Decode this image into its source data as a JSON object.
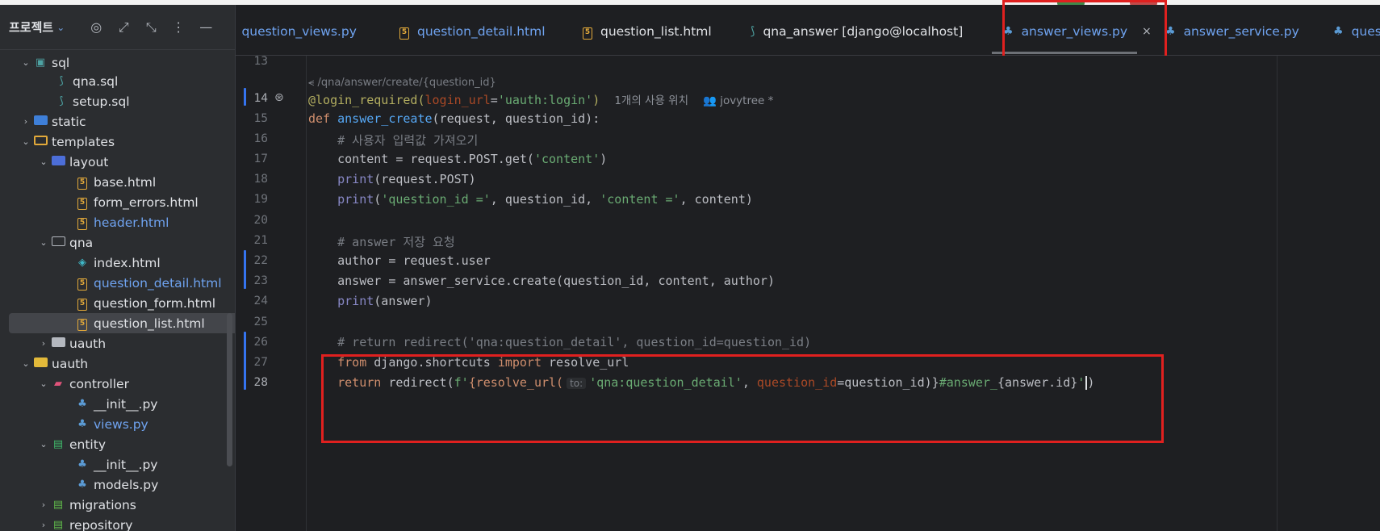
{
  "sidebar": {
    "title": "프로젝트",
    "tree": [
      {
        "label": "sql",
        "kind": "folder-sql",
        "expanded": true
      },
      {
        "label": "qna.sql",
        "kind": "sql"
      },
      {
        "label": "setup.sql",
        "kind": "sql"
      },
      {
        "label": "static",
        "kind": "folder-static",
        "expanded": false
      },
      {
        "label": "templates",
        "kind": "folder-templates",
        "expanded": true
      },
      {
        "label": "layout",
        "kind": "folder-layout",
        "expanded": true
      },
      {
        "label": "base.html",
        "kind": "html"
      },
      {
        "label": "form_errors.html",
        "kind": "html"
      },
      {
        "label": "header.html",
        "kind": "html",
        "modified": true
      },
      {
        "label": "qna",
        "kind": "folder",
        "expanded": true
      },
      {
        "label": "index.html",
        "kind": "html-alt"
      },
      {
        "label": "question_detail.html",
        "kind": "html",
        "modified": true
      },
      {
        "label": "question_form.html",
        "kind": "html"
      },
      {
        "label": "question_list.html",
        "kind": "html",
        "selected": true
      },
      {
        "label": "uauth",
        "kind": "folder",
        "expanded": false
      },
      {
        "label": "uauth",
        "kind": "folder-yellow",
        "expanded": true
      },
      {
        "label": "controller",
        "kind": "folder-controller",
        "expanded": true
      },
      {
        "label": "__init__.py",
        "kind": "py"
      },
      {
        "label": "views.py",
        "kind": "py",
        "modified": true
      },
      {
        "label": "entity",
        "kind": "folder-entity",
        "expanded": true
      },
      {
        "label": "__init__.py",
        "kind": "py"
      },
      {
        "label": "models.py",
        "kind": "py"
      },
      {
        "label": "migrations",
        "kind": "folder-migrations",
        "expanded": false
      },
      {
        "label": "repository",
        "kind": "folder-repo",
        "expanded": false
      }
    ]
  },
  "tabs": [
    {
      "label": "question_views.py",
      "icon": "none",
      "style": "blue"
    },
    {
      "label": "question_detail.html",
      "icon": "html",
      "style": "blue"
    },
    {
      "label": "question_list.html",
      "icon": "html",
      "style": "plain"
    },
    {
      "label": "qna_answer [django@localhost]",
      "icon": "sql",
      "style": "plain"
    },
    {
      "label": "answer_views.py",
      "icon": "py",
      "style": "active",
      "close": "×"
    },
    {
      "label": "answer_service.py",
      "icon": "py",
      "style": "blue"
    },
    {
      "label": "ques",
      "icon": "py",
      "style": "blue"
    }
  ],
  "editor": {
    "endpoint_hint": "/qna/answer/create/{question_id}",
    "usage_hint": "1개의 사용 위치",
    "author_hint": "jovytree *",
    "param_hint": "to:",
    "line_numbers": [
      "13",
      "14",
      "15",
      "16",
      "17",
      "18",
      "19",
      "20",
      "21",
      "22",
      "23",
      "24",
      "25",
      "26",
      "27",
      "28"
    ],
    "lines": {
      "l14": [
        "@login_required(",
        "login_url",
        "=",
        "'uauth:login'",
        ")"
      ],
      "l15": [
        "def ",
        "answer_create",
        "(request, question_id):"
      ],
      "l16": "    # 사용자 입력값 가져오기",
      "l17": [
        "    content = request.POST.get(",
        "'content'",
        ")"
      ],
      "l18": [
        "    ",
        "print",
        "(request.POST)"
      ],
      "l19": [
        "    ",
        "print",
        "(",
        "'question_id ='",
        ", question_id, ",
        "'content ='",
        ", content)"
      ],
      "l21": "    # answer 저장 요청",
      "l22": "    author = request.user",
      "l23": "    answer = answer_service.create(question_id, content, author)",
      "l24": [
        "    ",
        "print",
        "(answer)"
      ],
      "l26": "    # return redirect('qna:question_detail', question_id=question_id)",
      "l27": [
        "    ",
        "from",
        " django.shortcuts ",
        "import",
        " resolve_url"
      ],
      "l28": [
        "    ",
        "return",
        " redirect(",
        "f'",
        "{resolve_url(",
        "'qna:question_detail'",
        ", ",
        "question_id",
        "=question_id)}",
        "#answer_",
        "{answer.id}",
        "'",
        ")"
      ]
    }
  }
}
